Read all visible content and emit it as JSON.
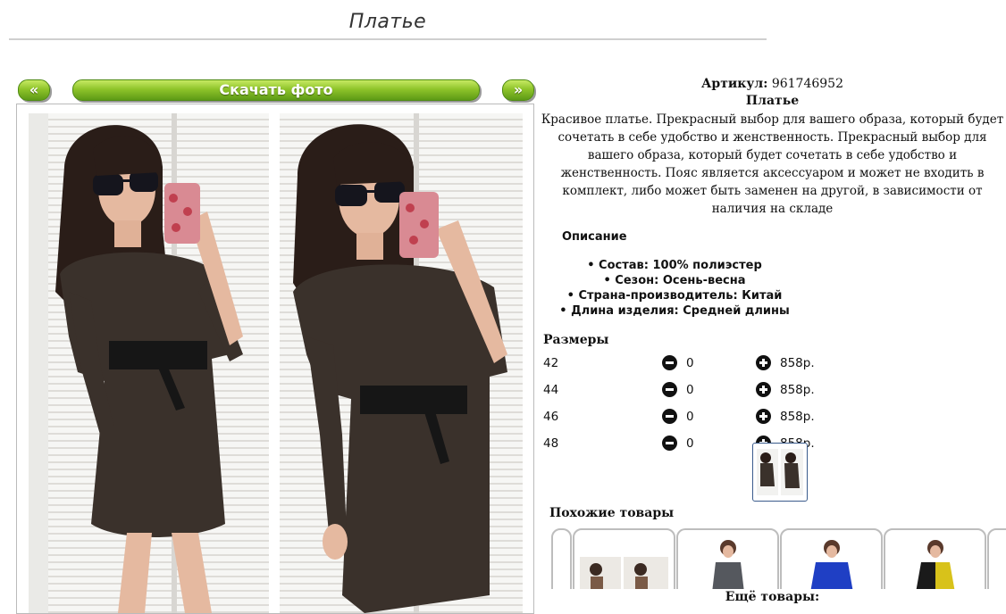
{
  "page": {
    "title": "Платье"
  },
  "nav": {
    "prev_label": "«",
    "download_label": "Скачать фото",
    "next_label": "»"
  },
  "product": {
    "article_label": "Артикул:",
    "article_value": "961746952",
    "name": "Платье",
    "description": "Красивое платье. Прекрасный выбор для вашего образа, который будет сочетать в себе удобство и женственность. Прекрасный выбор для вашего образа, который будет сочетать в себе удобство и женственность. Пояс является аксессуаром и может не входить в комплект, либо может быть заменен на другой, в зависимости от наличия на складе",
    "description_heading": "Описание",
    "properties": [
      "Состав: 100% полиэстер",
      "Сезон: Осень-весна",
      "Страна-производитель: Китай",
      "Длина изделия: Средней длины"
    ]
  },
  "sizes": {
    "heading": "Размеры",
    "rows": [
      {
        "size": "42",
        "qty": "0",
        "price": "858р."
      },
      {
        "size": "44",
        "qty": "0",
        "price": "858р."
      },
      {
        "size": "46",
        "qty": "0",
        "price": "858р."
      },
      {
        "size": "48",
        "qty": "0",
        "price": "858р."
      }
    ]
  },
  "similar": {
    "heading": "Похожие товары"
  },
  "more": {
    "heading": "Ещё товары:"
  },
  "colors": {
    "button_green": "#8fc42a",
    "dress": "#3a312b",
    "hair": "#2a1d18",
    "skin": "#e5b9a0",
    "shutter": "#f4f4f2"
  },
  "icons": {
    "minus": "minus-circle-icon",
    "plus": "plus-circle-icon"
  }
}
